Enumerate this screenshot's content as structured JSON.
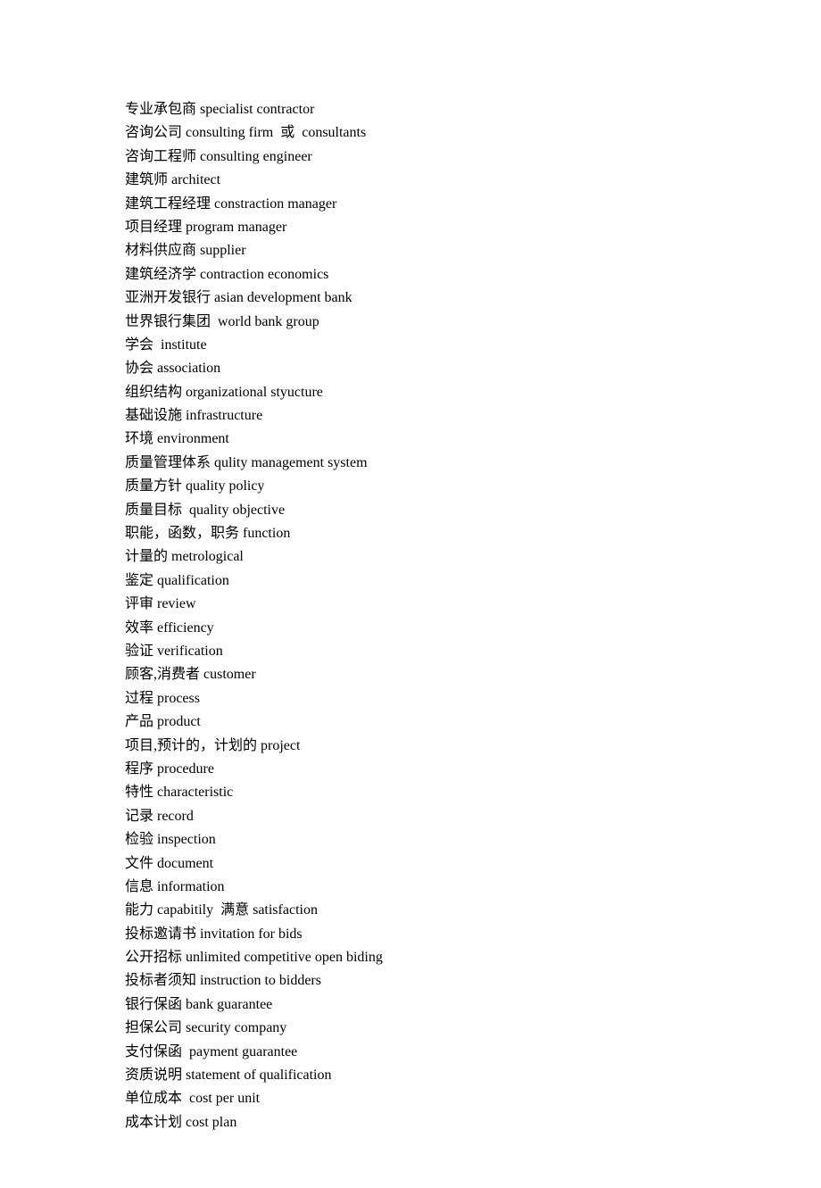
{
  "entries": [
    "专业承包商 specialist contractor",
    "咨询公司 consulting firm  或  consultants",
    "咨询工程师 consulting engineer",
    "建筑师 architect",
    "建筑工程经理 constraction manager",
    "项目经理 program manager",
    "材料供应商 supplier",
    "建筑经济学 contraction economics",
    "亚洲开发银行 asian development bank",
    "世界银行集团  world bank group",
    "学会  institute",
    "协会 association",
    "组织结构 organizational styucture",
    "基础设施 infrastructure",
    "环境 environment",
    "质量管理体系 qulity management system",
    "质量方针 quality policy",
    "质量目标  quality objective",
    "职能，函数，职务 function",
    "计量的 metrological",
    "鉴定 qualification",
    "评审 review",
    "效率 efficiency",
    "验证 verification",
    "顾客,消费者 customer",
    "过程 process",
    "产品 product",
    "项目,预计的，计划的 project",
    "程序 procedure",
    "特性 characteristic",
    "记录 record",
    "检验 inspection",
    "文件 document",
    "信息 information",
    "能力 capabitily  满意 satisfaction",
    "投标邀请书 invitation for bids",
    "公开招标 unlimited competitive open biding",
    "投标者须知 instruction to bidders",
    "银行保函 bank guarantee",
    "担保公司 security company",
    "支付保函  payment guarantee",
    "资质说明 statement of qualification",
    "单位成本  cost per unit",
    "成本计划 cost plan"
  ]
}
